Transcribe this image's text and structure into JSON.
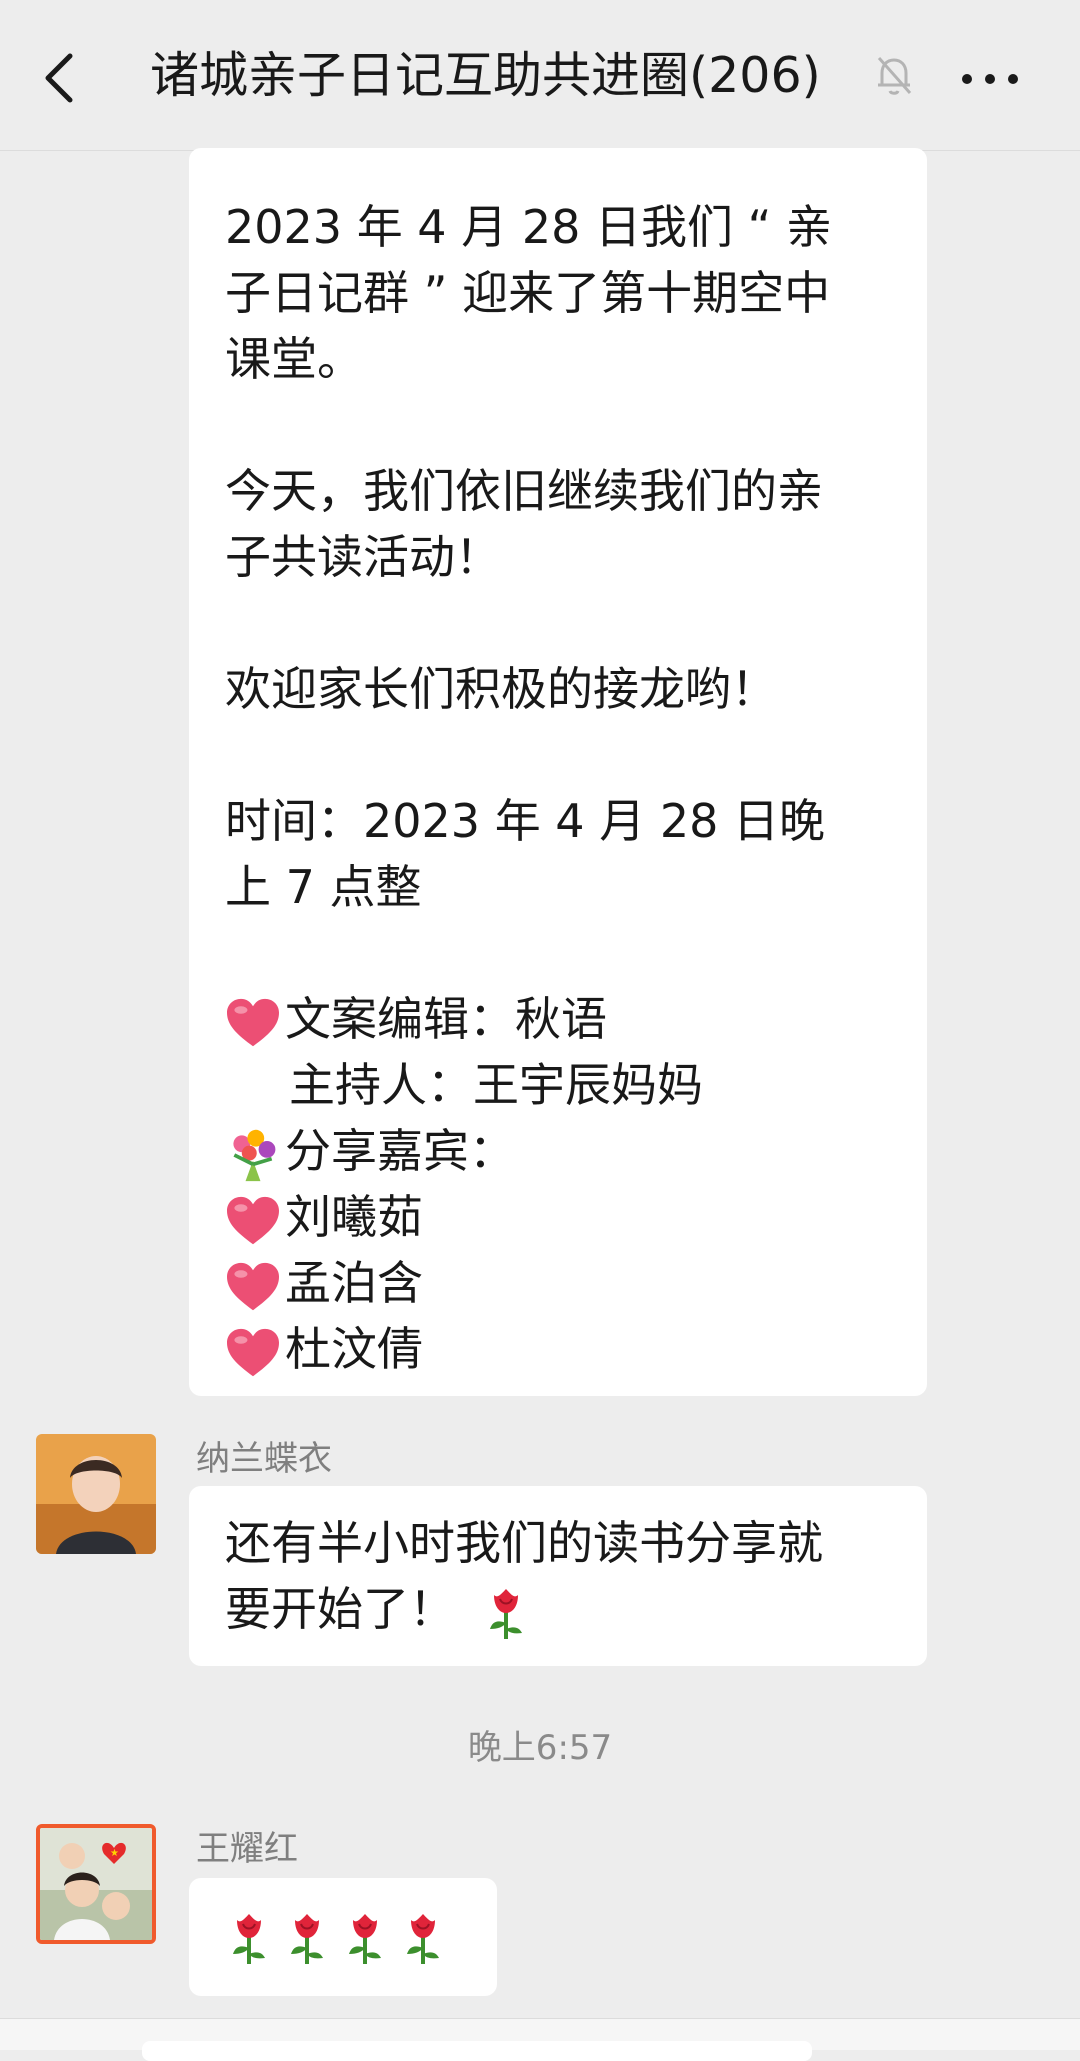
{
  "header": {
    "title": "诸城亲子日记互助共进圈(206)",
    "back_icon": "chevron-left-icon",
    "mute_icon": "bell-off-icon",
    "more_icon": "more-dots-icon"
  },
  "messages": [
    {
      "type": "text",
      "lines": [
        "2023 年 4 月 28 日我们 “ 亲",
        "子日记群 ” 迎来了第十期空中",
        "课堂。",
        "今天，我们依旧继续我们的亲",
        "子共读活动！",
        "欢迎家长们积极的接龙哟！",
        "时间：2023 年 4 月 28 日晚",
        "上 7 点整",
        "文案编辑：秋语",
        "主持人：王宇辰妈妈",
        "分享嘉宾：",
        "刘曦茹",
        "孟泊含",
        "杜汶倩"
      ]
    },
    {
      "type": "text",
      "sender": "纳兰蝶衣",
      "lines": [
        "还有半小时我们的读书分享就",
        "要开始了！"
      ]
    },
    {
      "type": "timestamp",
      "text": "晚上6:57"
    },
    {
      "type": "emoji",
      "sender": "王耀红",
      "emoji": "rose-icon",
      "count": 4
    }
  ],
  "colors": {
    "background": "#ededed",
    "bubble": "#ffffff",
    "heart": "#ec4f74",
    "rose": "#e0243a",
    "stem": "#3c8f2d",
    "avatar_border": "#f05a2c"
  }
}
